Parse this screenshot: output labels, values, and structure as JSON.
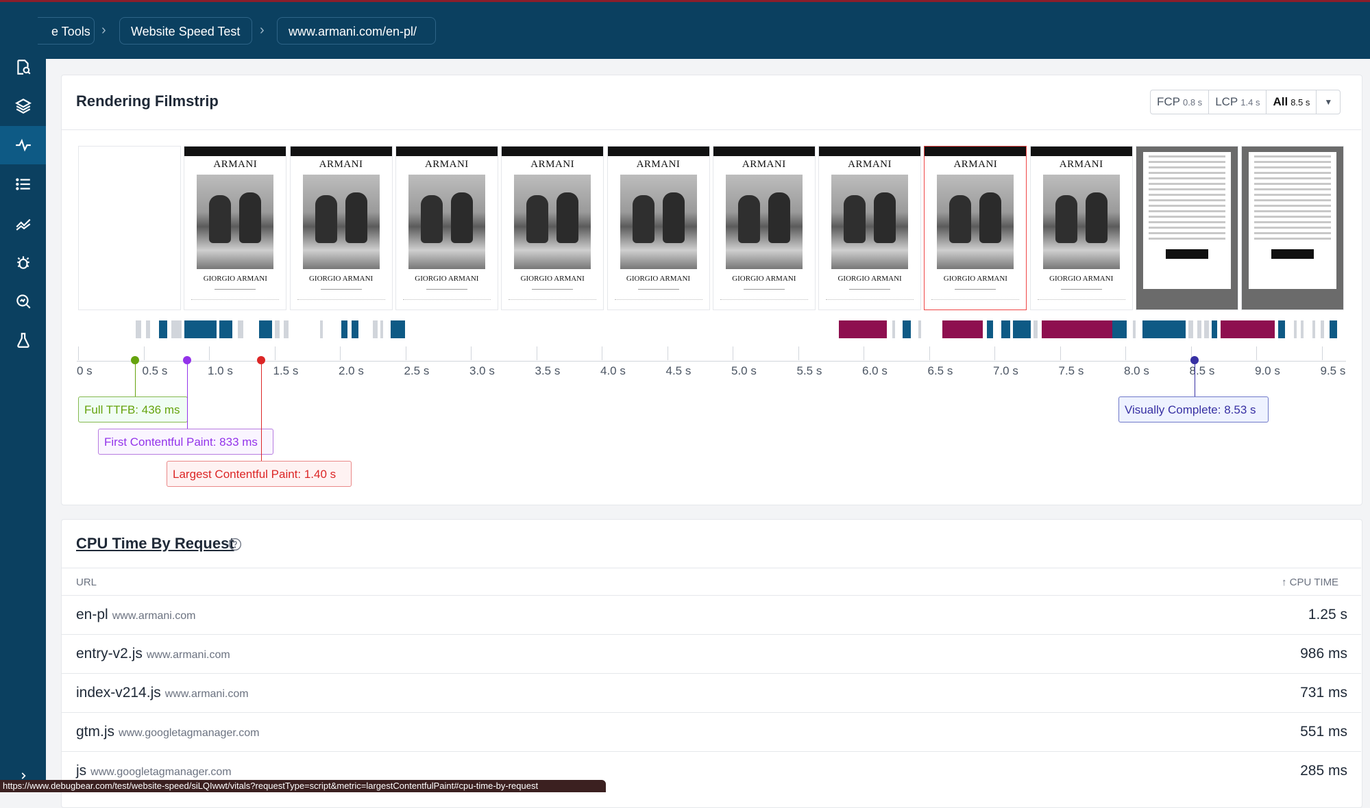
{
  "breadcrumb": {
    "items": [
      "e Tools",
      "Website Speed Test",
      "www.armani.com/en-pl/"
    ],
    "separator": "›"
  },
  "sidebar": {
    "icons": [
      "page-search-icon",
      "layers-icon",
      "vitals-pulse-icon",
      "list-icon",
      "trend-icon",
      "bug-icon",
      "magnify-icon",
      "flask-icon"
    ],
    "active_index": 2
  },
  "filmstrip": {
    "title": "Rendering Filmstrip",
    "toggle": [
      {
        "label": "FCP",
        "value": "0.8 s"
      },
      {
        "label": "LCP",
        "value": "1.4 s"
      },
      {
        "label": "All",
        "value": "8.5 s",
        "selected": true
      }
    ],
    "frame_text": {
      "logo": "ARMANI",
      "brand": "GIORGIO ARMANI"
    },
    "frame_types": [
      "empty",
      "page",
      "page",
      "page",
      "page",
      "page",
      "page",
      "page",
      "page-lcp",
      "page",
      "dialog",
      "dialog"
    ],
    "axis_ticks": [
      "0 s",
      "0.5 s",
      "1.0 s",
      "1.5 s",
      "2.0 s",
      "2.5 s",
      "3.0 s",
      "3.5 s",
      "4.0 s",
      "4.5 s",
      "5.0 s",
      "5.5 s",
      "6.0 s",
      "6.5 s",
      "7.0 s",
      "7.5 s",
      "8.0 s",
      "8.5 s",
      "9.0 s",
      "9.5 s"
    ],
    "axis_max_s": 9.7,
    "markers": [
      {
        "label": "Full TTFB: 436 ms",
        "time_s": 0.436,
        "color": "#65a30d",
        "bg": "#f0fdf4",
        "border": "#86b84f"
      },
      {
        "label": "First Contentful Paint: 833 ms",
        "time_s": 0.833,
        "color": "#9333ea",
        "bg": "#faf5ff",
        "border": "#b77be0"
      },
      {
        "label": "Largest Contentful Paint: 1.40 s",
        "time_s": 1.4,
        "color": "#dc2626",
        "bg": "#fef2f2",
        "border": "#e98888"
      },
      {
        "label": "Visually Complete: 8.53 s",
        "time_s": 8.53,
        "color": "#3730a3",
        "bg": "#eef2ff",
        "border": "#6f78c8"
      }
    ],
    "activity_blocks": [
      {
        "start": 0.44,
        "end": 0.48,
        "color": "#d1d5db"
      },
      {
        "start": 0.52,
        "end": 0.55,
        "color": "#d1d5db"
      },
      {
        "start": 0.62,
        "end": 0.68,
        "color": "#0e5a85"
      },
      {
        "start": 0.71,
        "end": 0.79,
        "color": "#d1d5db"
      },
      {
        "start": 0.81,
        "end": 1.06,
        "color": "#0e5a85"
      },
      {
        "start": 1.08,
        "end": 1.18,
        "color": "#0e5a85"
      },
      {
        "start": 1.22,
        "end": 1.26,
        "color": "#d1d5db"
      },
      {
        "start": 1.38,
        "end": 1.48,
        "color": "#0e5a85"
      },
      {
        "start": 1.5,
        "end": 1.54,
        "color": "#d1d5db"
      },
      {
        "start": 1.57,
        "end": 1.61,
        "color": "#d1d5db"
      },
      {
        "start": 1.85,
        "end": 1.87,
        "color": "#d1d5db"
      },
      {
        "start": 2.01,
        "end": 2.06,
        "color": "#0e5a85"
      },
      {
        "start": 2.09,
        "end": 2.14,
        "color": "#0e5a85"
      },
      {
        "start": 2.25,
        "end": 2.29,
        "color": "#d1d5db"
      },
      {
        "start": 2.31,
        "end": 2.33,
        "color": "#d1d5db"
      },
      {
        "start": 2.39,
        "end": 2.5,
        "color": "#0e5a85"
      },
      {
        "start": 5.81,
        "end": 6.18,
        "color": "#8e0f4f"
      },
      {
        "start": 6.22,
        "end": 6.24,
        "color": "#d1d5db"
      },
      {
        "start": 6.3,
        "end": 6.36,
        "color": "#0e5a85"
      },
      {
        "start": 6.42,
        "end": 6.44,
        "color": "#d1d5db"
      },
      {
        "start": 6.6,
        "end": 6.91,
        "color": "#8e0f4f"
      },
      {
        "start": 6.94,
        "end": 6.99,
        "color": "#0e5a85"
      },
      {
        "start": 7.05,
        "end": 7.12,
        "color": "#0e5a85"
      },
      {
        "start": 7.14,
        "end": 7.28,
        "color": "#0e5a85"
      },
      {
        "start": 7.3,
        "end": 7.33,
        "color": "#d1d5db"
      },
      {
        "start": 7.36,
        "end": 7.9,
        "color": "#8e0f4f"
      },
      {
        "start": 7.9,
        "end": 8.01,
        "color": "#0e5a85"
      },
      {
        "start": 8.06,
        "end": 8.08,
        "color": "#d1d5db"
      },
      {
        "start": 8.13,
        "end": 8.36,
        "color": "#0e5a85"
      },
      {
        "start": 8.36,
        "end": 8.46,
        "color": "#0e5a85"
      },
      {
        "start": 8.48,
        "end": 8.52,
        "color": "#d1d5db"
      },
      {
        "start": 8.55,
        "end": 8.58,
        "color": "#d1d5db"
      },
      {
        "start": 8.6,
        "end": 8.64,
        "color": "#d1d5db"
      },
      {
        "start": 8.66,
        "end": 8.7,
        "color": "#0e5a85"
      },
      {
        "start": 8.73,
        "end": 9.14,
        "color": "#8e0f4f"
      },
      {
        "start": 9.17,
        "end": 9.22,
        "color": "#0e5a85"
      },
      {
        "start": 9.29,
        "end": 9.31,
        "color": "#d1d5db"
      },
      {
        "start": 9.34,
        "end": 9.36,
        "color": "#d1d5db"
      },
      {
        "start": 9.43,
        "end": 9.45,
        "color": "#d1d5db"
      },
      {
        "start": 9.49,
        "end": 9.52,
        "color": "#d1d5db"
      },
      {
        "start": 9.56,
        "end": 9.62,
        "color": "#0e5a85"
      }
    ]
  },
  "cpu": {
    "title": "CPU Time By Request",
    "col_url": "URL",
    "col_time": "↑ CPU TIME",
    "rows": [
      {
        "name": "en-pl",
        "host": "www.armani.com",
        "time": "1.25 s"
      },
      {
        "name": "entry-v2.js",
        "host": "www.armani.com",
        "time": "986 ms"
      },
      {
        "name": "index-v214.js",
        "host": "www.armani.com",
        "time": "731 ms"
      },
      {
        "name": "gtm.js",
        "host": "www.googletagmanager.com",
        "time": "551 ms"
      },
      {
        "name": "js",
        "host": "www.googletagmanager.com",
        "time": "285 ms"
      }
    ]
  },
  "status_url": "https://www.debugbear.com/test/website-speed/siLQIwwt/vitals?requestType=script&metric=largestContentfulPaint#cpu-time-by-request"
}
